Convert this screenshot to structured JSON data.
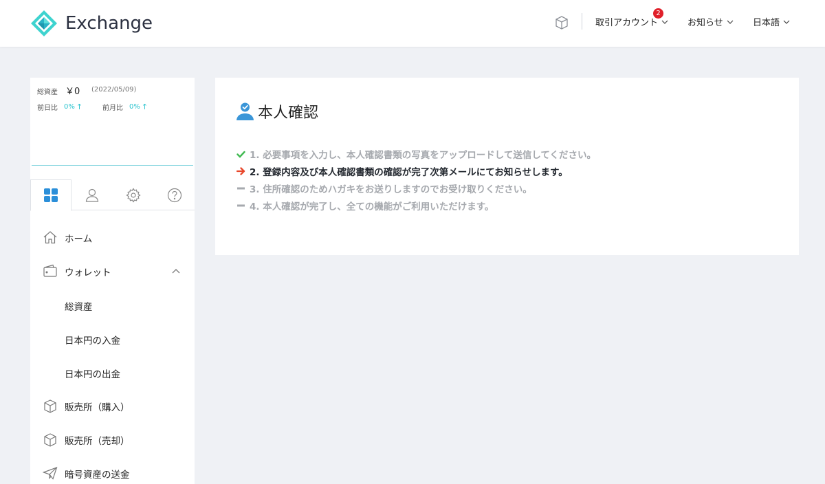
{
  "header": {
    "brand": "Exchange",
    "menus": [
      {
        "label": "取引アカウント",
        "badge": "2"
      },
      {
        "label": "お知らせ"
      },
      {
        "label": "日本語"
      }
    ]
  },
  "sidebar": {
    "summary": {
      "total_label": "総資産",
      "total_value": "￥0",
      "date": "(2022/05/09)",
      "day_label": "前日比",
      "day_value": "0%",
      "month_label": "前月比",
      "month_value": "0%",
      "up_arrow": "↑"
    },
    "tabs": [
      {
        "name": "dashboard",
        "active": true
      },
      {
        "name": "profile",
        "active": false
      },
      {
        "name": "settings",
        "active": false
      },
      {
        "name": "help",
        "active": false
      }
    ],
    "nav": [
      {
        "label": "ホーム",
        "icon": "home-icon"
      },
      {
        "label": "ウォレット",
        "icon": "wallet-icon",
        "expanded": true,
        "children": [
          "総資産",
          "日本円の入金",
          "日本円の出金"
        ]
      },
      {
        "label": "販売所（購入）",
        "icon": "cube-icon"
      },
      {
        "label": "販売所（売却）",
        "icon": "cube-icon"
      },
      {
        "label": "暗号資産の送金",
        "icon": "send-icon"
      }
    ]
  },
  "main": {
    "title": "本人確認",
    "steps": [
      {
        "text": "1. 必要事項を入力し、本人確認書類の写真をアップロードして送信してください。",
        "status": "done"
      },
      {
        "text": "2. 登録内容及び本人確認書類の確認が完了次第メールにてお知らせします。",
        "status": "current"
      },
      {
        "text": "3. 住所確認のためハガキをお送りしますのでお受け取りください。",
        "status": "pending"
      },
      {
        "text": "4. 本人確認が完了し、全ての機能がご利用いただけます。",
        "status": "pending"
      }
    ]
  },
  "colors": {
    "accent": "#2bc4cf",
    "check": "#3fb950",
    "current_arrow": "#e8472b",
    "badge": "#e0202a"
  }
}
